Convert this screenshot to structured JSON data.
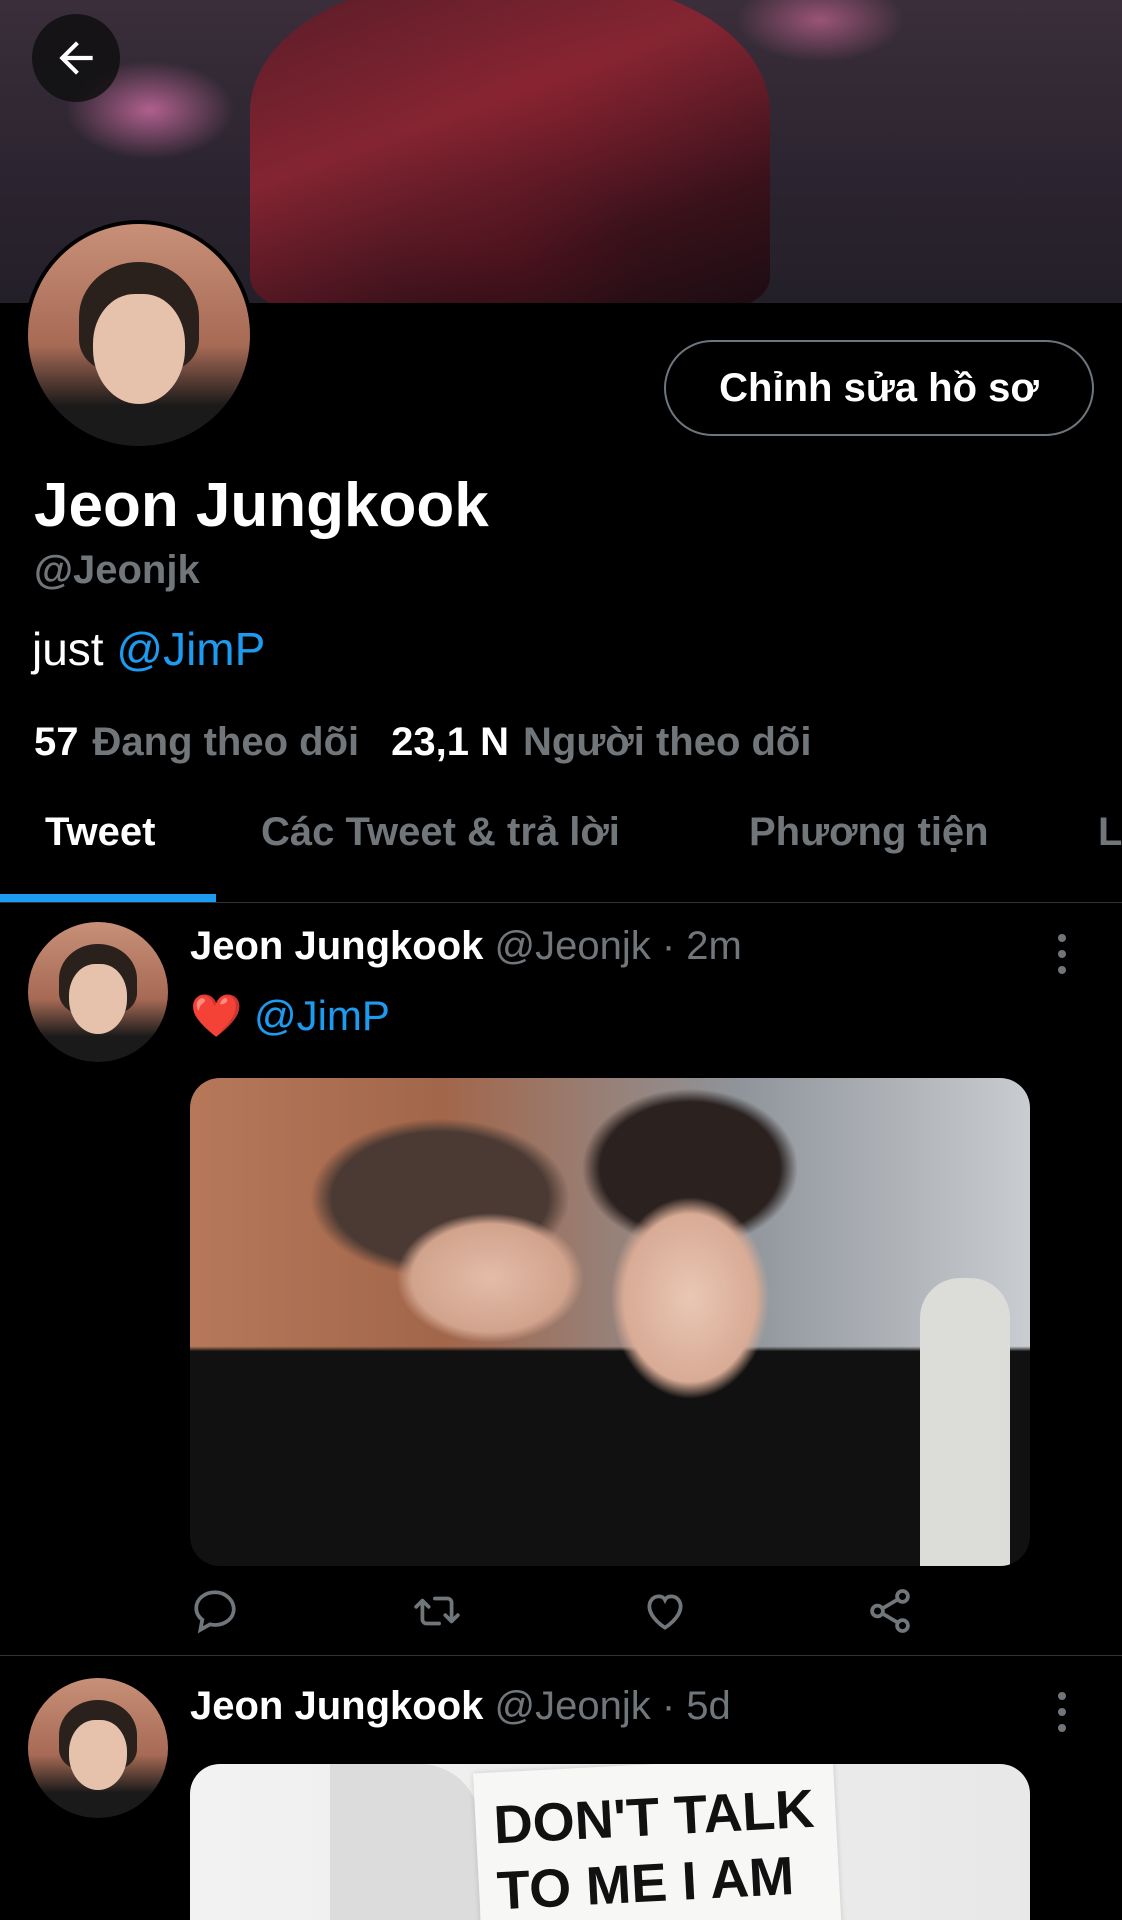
{
  "profile": {
    "name": "Jeon Jungkook",
    "handle": "@Jeonjk",
    "bio_text": "just ",
    "bio_mention": "@JimP",
    "edit_button": "Chỉnh sửa hồ sơ",
    "following_count": "57",
    "following_label": "Đang theo dõi",
    "followers_count": "23,1 N",
    "followers_label": "Người theo dõi"
  },
  "tabs": [
    {
      "label": "Tweet",
      "active": true
    },
    {
      "label": "Các Tweet & trả lời",
      "active": false
    },
    {
      "label": "Phương tiện",
      "active": false
    },
    {
      "label": "L",
      "active": false
    }
  ],
  "tweets": [
    {
      "name": "Jeon Jungkook",
      "meta": "@Jeonjk · 2m",
      "emoji": "❤️",
      "text": "@JimP",
      "icons": [
        "reply-icon",
        "retweet-icon",
        "like-icon",
        "share-icon"
      ]
    },
    {
      "name": "Jeon Jungkook",
      "meta": "@Jeonjk · 5d",
      "sign_line1": "DON'T TALK",
      "sign_line2": "TO ME I AM"
    }
  ],
  "colors": {
    "accent": "#1d9bf0",
    "muted": "#71767b",
    "background": "#000000"
  }
}
